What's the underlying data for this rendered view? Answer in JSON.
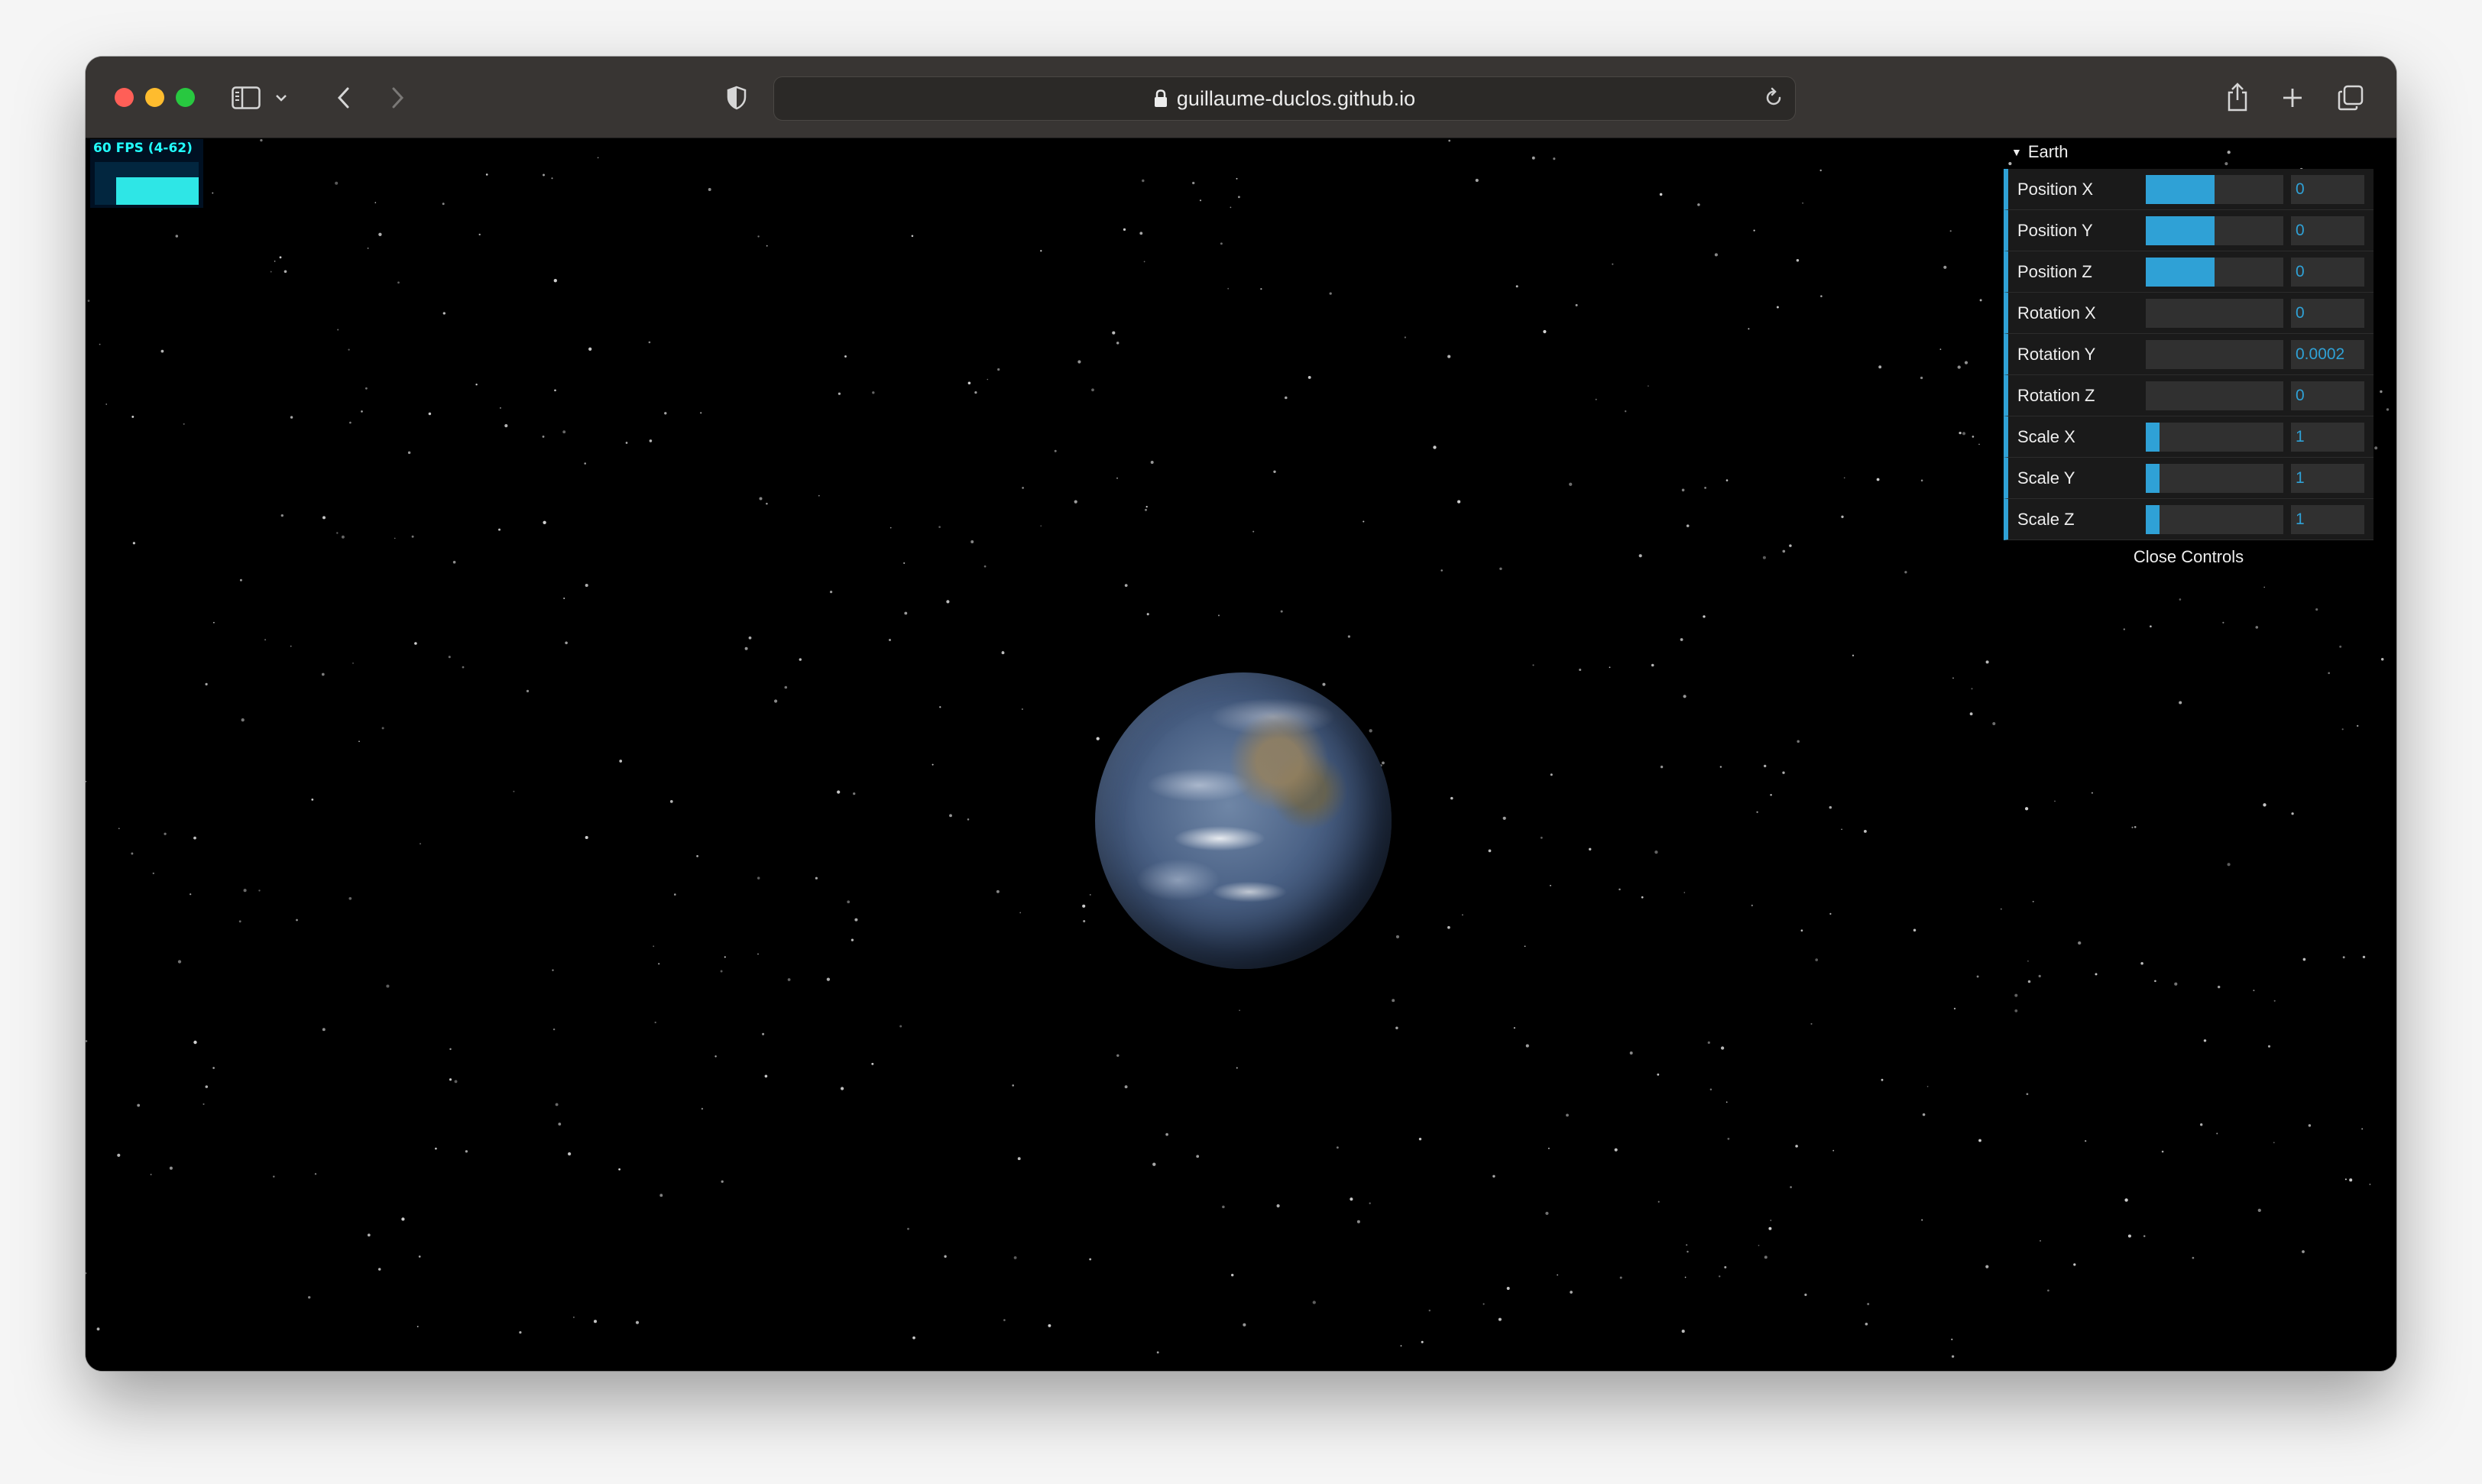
{
  "browser": {
    "url": "guillaume-duclos.github.io"
  },
  "fps": {
    "label": "60 FPS (4-62)"
  },
  "gui": {
    "folder_title": "Earth",
    "close_label": "Close Controls",
    "controls": [
      {
        "label": "Position X",
        "value": "0",
        "fill": 0.5
      },
      {
        "label": "Position Y",
        "value": "0",
        "fill": 0.5
      },
      {
        "label": "Position Z",
        "value": "0",
        "fill": 0.5
      },
      {
        "label": "Rotation X",
        "value": "0",
        "fill": 0
      },
      {
        "label": "Rotation Y",
        "value": "0.0002",
        "fill": 0
      },
      {
        "label": "Rotation Z",
        "value": "0",
        "fill": 0
      },
      {
        "label": "Scale X",
        "value": "1",
        "fill": 0.1
      },
      {
        "label": "Scale Y",
        "value": "1",
        "fill": 0.1
      },
      {
        "label": "Scale Z",
        "value": "1",
        "fill": 0.1
      }
    ]
  },
  "colors": {
    "accent": "#2fa1d6",
    "toolbar": "#383533",
    "fps_text": "#22ffff"
  }
}
